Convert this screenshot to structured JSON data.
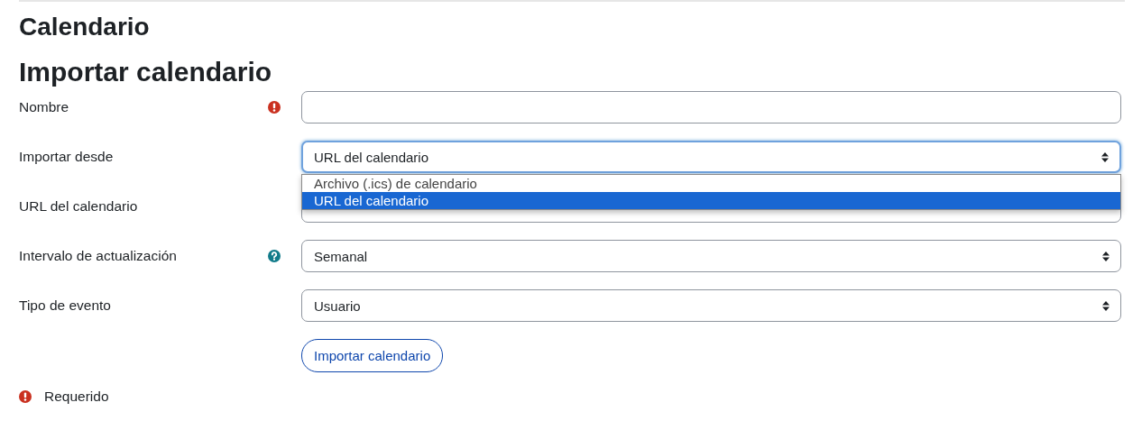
{
  "page": {
    "title": "Calendario",
    "heading": "Importar calendario"
  },
  "fields": [
    {
      "label": "Nombre",
      "kind": "text",
      "required": true,
      "help": false,
      "focused": false
    },
    {
      "label": "Importar desde",
      "kind": "select",
      "required": false,
      "help": false,
      "value": "URL del calendario",
      "focused": true,
      "open": true,
      "options": [
        {
          "label": "Archivo (.ics) de calendario",
          "selected": false
        },
        {
          "label": "URL del calendario",
          "selected": true
        }
      ]
    },
    {
      "label": "URL del calendario",
      "kind": "text",
      "required": false,
      "help": false,
      "focused": false
    },
    {
      "label": "Intervalo de actualización",
      "kind": "select",
      "required": false,
      "help": true,
      "value": "Semanal",
      "focused": false,
      "open": false
    },
    {
      "label": "Tipo de evento",
      "kind": "select",
      "required": false,
      "help": false,
      "value": "Usuario",
      "focused": false,
      "open": false
    }
  ],
  "submit": {
    "label": "Importar calendario"
  },
  "legend": {
    "text": "Requerido"
  }
}
